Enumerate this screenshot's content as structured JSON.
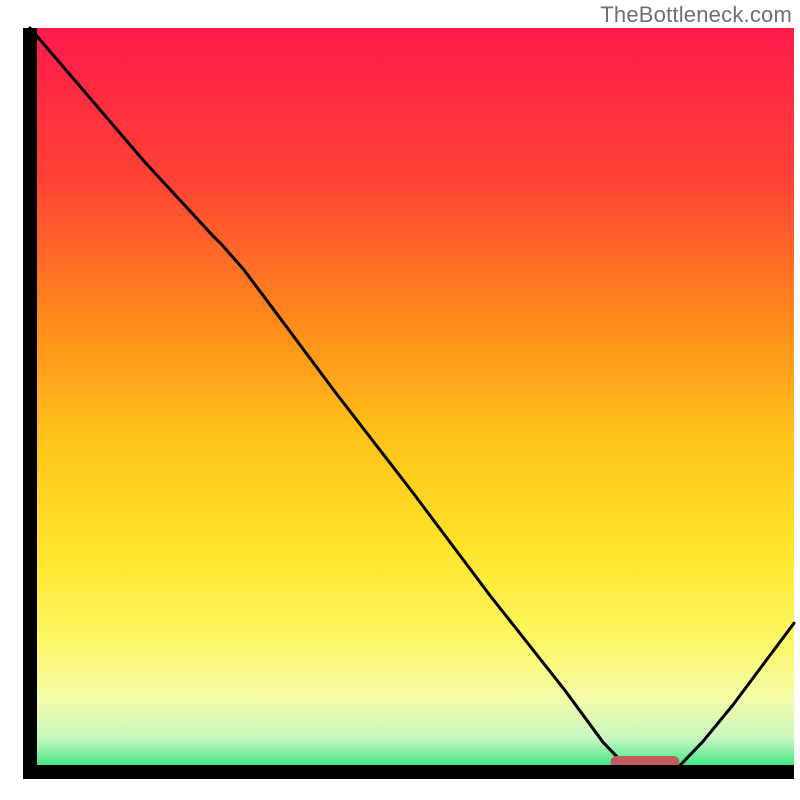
{
  "watermark": "TheBottleneck.com",
  "chart_data": {
    "type": "line",
    "title": "",
    "xlabel": "",
    "ylabel": "",
    "xlim": [
      0,
      100
    ],
    "ylim": [
      0,
      100
    ],
    "marker": {
      "x_range": [
        76,
        85
      ],
      "y": 0
    },
    "series": [
      {
        "name": "curve",
        "x": [
          0,
          5,
          15,
          24,
          25,
          28,
          32,
          40,
          50,
          60,
          70,
          75,
          78,
          80,
          82,
          85,
          88,
          92,
          96,
          100
        ],
        "y": [
          100,
          94,
          82,
          72,
          71,
          67.5,
          62,
          51,
          37.7,
          24,
          11,
          4,
          0.8,
          0,
          0,
          0.8,
          4,
          9,
          14.5,
          20
        ]
      }
    ],
    "gradient_hues_top_to_bottom": [
      {
        "pos": 0.0,
        "color": "#ff1a4b"
      },
      {
        "pos": 0.2,
        "color": "#ff4136"
      },
      {
        "pos": 0.4,
        "color": "#ff8c1a"
      },
      {
        "pos": 0.55,
        "color": "#ffc21a"
      },
      {
        "pos": 0.7,
        "color": "#ffe429"
      },
      {
        "pos": 0.82,
        "color": "#fdf763"
      },
      {
        "pos": 0.9,
        "color": "#f4fca8"
      },
      {
        "pos": 0.955,
        "color": "#c7f7c0"
      },
      {
        "pos": 0.985,
        "color": "#59eb8f"
      },
      {
        "pos": 1.0,
        "color": "#18d15a"
      }
    ]
  }
}
